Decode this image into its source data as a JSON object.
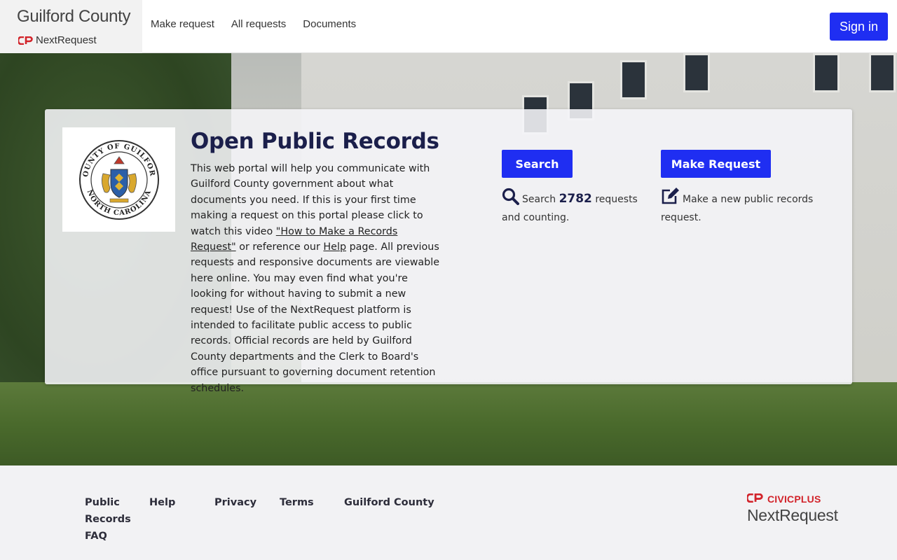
{
  "header": {
    "org_name": "Guilford County",
    "product_name": "NextRequest",
    "nav": [
      "Make request",
      "All requests",
      "Documents"
    ],
    "signin_label": "Sign in"
  },
  "hero": {
    "title": "Open Public Records",
    "desc_part1": "This web portal will help you communicate with Guilford County government about what documents you need. If this is your first time making a request on this portal please click to watch this video ",
    "video_link": "\"How to Make a Records Request\"",
    "desc_part2": " or reference our ",
    "help_link": "Help",
    "desc_part3": " page.  All previous requests and responsive documents are viewable here online. You may even find what you're looking for without having to submit a new request!  Use of the NextRequest platform is intended to facilitate public access to public records. Official records are held by Guilford County departments and the Clerk to Board's office pursuant to governing document retention schedules.",
    "search_button": "Search",
    "make_button": "Make Request",
    "search_prefix": "Search",
    "request_count": "2782",
    "search_suffix": "requests and counting.",
    "make_blurb": "Make a new public records request.",
    "seal_top": "COUNTY OF GUILFORD",
    "seal_bottom": "NORTH CAROLINA"
  },
  "footer": {
    "links": [
      "Public Records FAQ",
      "Help",
      "Privacy",
      "Terms",
      "Guilford County"
    ],
    "civic_brand": "CIVICPLUS",
    "civic_product": "NextRequest"
  },
  "colors": {
    "primary": "#1f2ef2",
    "title": "#1b1f4b",
    "brand_red": "#d2232a"
  },
  "icons": {
    "search": "magnifier-icon",
    "make": "edit-icon"
  }
}
